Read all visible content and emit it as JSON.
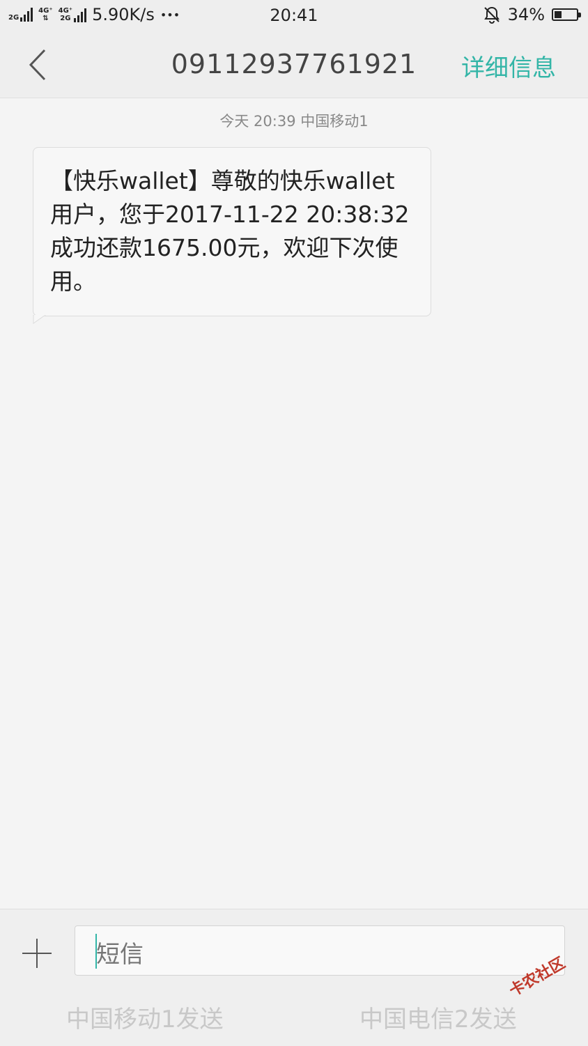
{
  "status_bar": {
    "network1": "2G",
    "network2_top": "4G⁺",
    "network3_top": "4G⁺",
    "network3_bottom": "2G",
    "speed": "5.90K/s",
    "more": "•••",
    "time": "20:41",
    "battery_percent": "34%",
    "battery_level": 0.34
  },
  "header": {
    "title": "09112937761921",
    "details_label": "详细信息"
  },
  "conversation": {
    "timestamp": "今天  20:39  中国移动1",
    "messages": [
      {
        "text": "【快乐wallet】尊敬的快乐wallet用户，您于2017-11-22 20:38:32成功还款1675.00元，欢迎下次使用。"
      }
    ]
  },
  "composer": {
    "placeholder": "短信",
    "send_sim1": "中国移动1发送",
    "send_sim2": "中国电信2发送"
  },
  "watermark": "卡农社区",
  "colors": {
    "accent": "#33b5a7"
  }
}
